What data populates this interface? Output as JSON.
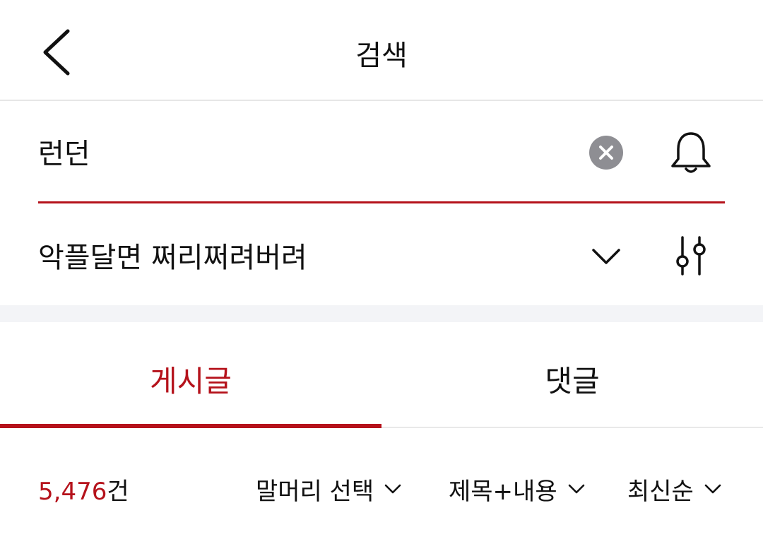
{
  "header": {
    "title": "검색",
    "back_icon": "chevron-left-icon"
  },
  "search": {
    "value": "런던",
    "clear_icon": "clear-circle-icon",
    "alert_icon": "bell-icon"
  },
  "board": {
    "selected": "악플달면 쩌리쩌려버려",
    "dropdown_icon": "chevron-down-icon",
    "filter_icon": "filter-sliders-icon"
  },
  "tabs": [
    {
      "label": "게시글",
      "active": true
    },
    {
      "label": "댓글",
      "active": false
    }
  ],
  "results": {
    "count": "5,476",
    "count_unit": "건",
    "filters": {
      "header_select": "말머리 선택",
      "scope": "제목+내용",
      "sort": "최신순"
    }
  },
  "colors": {
    "accent": "#b5121b",
    "divider": "#e6e6e6",
    "band": "#f3f4f7",
    "clear_button": "#8e8e93"
  }
}
